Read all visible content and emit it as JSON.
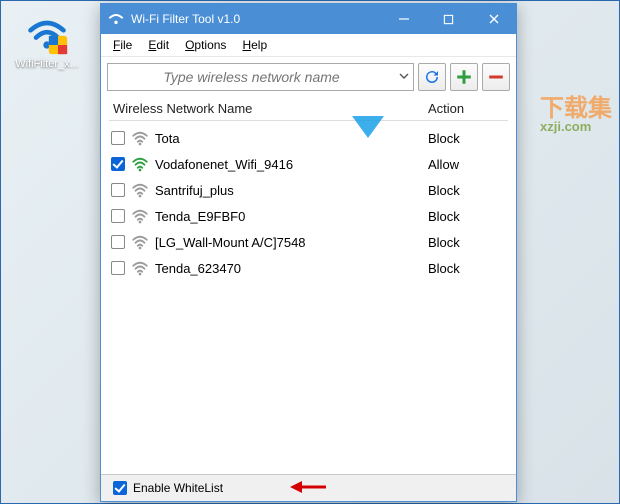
{
  "desktop": {
    "icon_label": "WifiFilter_x..."
  },
  "window": {
    "title": "Wi-Fi Filter Tool v1.0",
    "menus": {
      "file": "File",
      "edit": "Edit",
      "options": "Options",
      "help": "Help"
    },
    "search": {
      "placeholder": "Type wireless network name"
    },
    "list": {
      "header_name": "Wireless Network Name",
      "header_action": "Action",
      "rows": [
        {
          "checked": false,
          "signal": "weak",
          "name": "Tota",
          "action": "Block"
        },
        {
          "checked": true,
          "signal": "strong",
          "name": "Vodafonenet_Wifi_9416",
          "action": "Allow"
        },
        {
          "checked": false,
          "signal": "weak",
          "name": "Santrifuj_plus",
          "action": "Block"
        },
        {
          "checked": false,
          "signal": "weak",
          "name": "Tenda_E9FBF0",
          "action": "Block"
        },
        {
          "checked": false,
          "signal": "weak",
          "name": "[LG_Wall-Mount A/C]7548",
          "action": "Block"
        },
        {
          "checked": false,
          "signal": "weak",
          "name": "Tenda_623470",
          "action": "Block"
        }
      ]
    },
    "footer": {
      "enable_label": "Enable WhiteList",
      "enable_checked": true
    }
  },
  "watermark": {
    "cn": "下载集",
    "domain": "xzji.com"
  }
}
